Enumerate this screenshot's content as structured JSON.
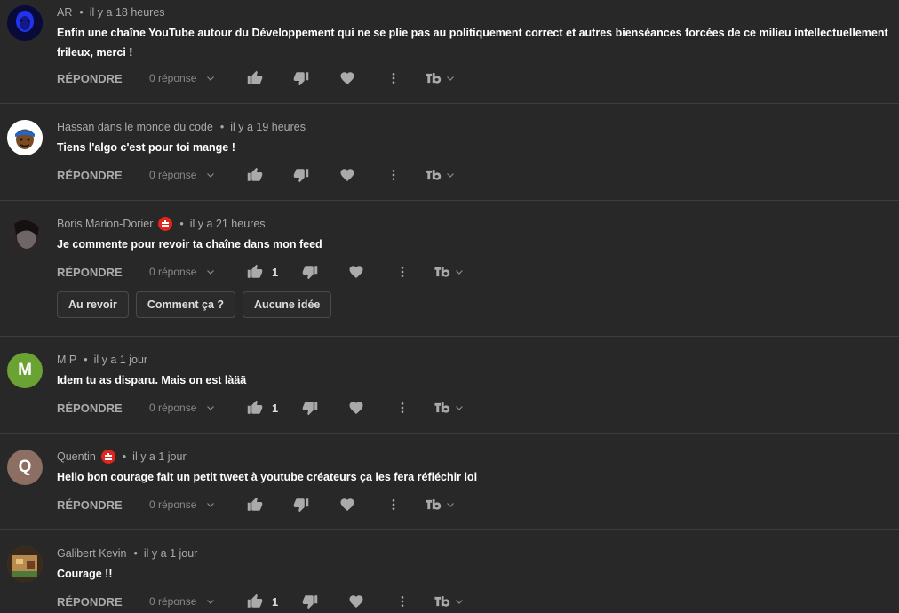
{
  "labels": {
    "reply": "RÉPONDRE",
    "reply_count": "0 réponse",
    "dot": "•"
  },
  "comments": [
    {
      "author": "AR",
      "time": "il y a 18 heures",
      "text": "Enfin une chaîne YouTube autour du Développement qui ne se plie pas au politiquement correct et autres bienséances forcées de ce milieu intellectuellement frileux, merci !",
      "likes": "",
      "avatar_initial": "",
      "avatar_color": "#1a2bd6"
    },
    {
      "author": "Hassan dans le monde du code",
      "time": "il y a 19 heures",
      "text": "Tiens l'algo c'est pour toi mange !",
      "likes": "",
      "avatar_initial": "",
      "avatar_color": "#ffffff"
    },
    {
      "author": "Boris Marion-Dorier",
      "time": "il y a 21 heures",
      "text": "Je commente pour revoir ta chaîne dans mon feed",
      "likes": "1",
      "avatar_initial": "",
      "avatar_color": "#3a3536",
      "suggestions": [
        "Au revoir",
        "Comment ça ?",
        "Aucune idée"
      ]
    },
    {
      "author": "M P",
      "time": "il y a 1 jour",
      "text": "Idem tu as disparu. Mais on est làää",
      "likes": "1",
      "avatar_initial": "M",
      "avatar_color": "#6aa233"
    },
    {
      "author": "Quentin",
      "time": "il y a 1 jour",
      "text": "Hello bon courage fait un petit tweet à youtube créateurs ça les fera réfléchir lol",
      "likes": "",
      "avatar_initial": "Q",
      "avatar_color": "#8d6e63"
    },
    {
      "author": "Galibert Kevin",
      "time": "il y a 1 jour",
      "text": "Courage !!",
      "likes": "1",
      "avatar_initial": "",
      "avatar_color": "#7a5a3a"
    }
  ]
}
